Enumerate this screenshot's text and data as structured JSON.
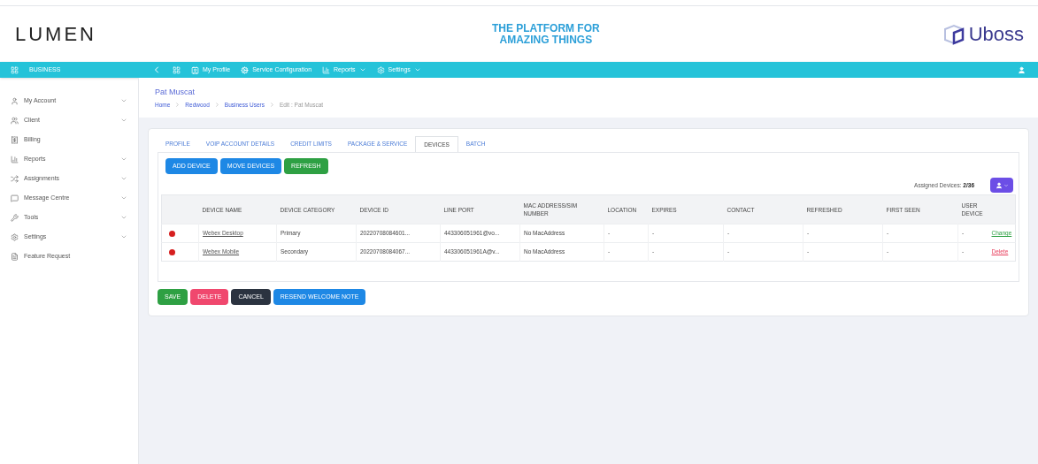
{
  "header": {
    "logo": "LUMEN",
    "tagline": [
      "THE PLATFORM FOR",
      "AMAZING THINGS"
    ],
    "brand": "Uboss"
  },
  "navbar": {
    "section": "BUSINESS",
    "items": [
      {
        "label": "My Profile",
        "kind": "profile",
        "dropdown": false
      },
      {
        "label": "Service Configuration",
        "kind": "config",
        "dropdown": false
      },
      {
        "label": "Reports",
        "kind": "reports",
        "dropdown": true
      },
      {
        "label": "Settings",
        "kind": "settings",
        "dropdown": true
      }
    ]
  },
  "sidebar": {
    "items": [
      {
        "label": "My Account",
        "kind": "user",
        "has_submenu": true
      },
      {
        "label": "Client",
        "kind": "users",
        "has_submenu": true
      },
      {
        "label": "Billing",
        "kind": "billing",
        "has_submenu": false
      },
      {
        "label": "Reports",
        "kind": "chart",
        "has_submenu": true
      },
      {
        "label": "Assignments",
        "kind": "assign",
        "has_submenu": true
      },
      {
        "label": "Message Centre",
        "kind": "message",
        "has_submenu": true
      },
      {
        "label": "Tools",
        "kind": "tools",
        "has_submenu": true
      },
      {
        "label": "Settings",
        "kind": "settings",
        "has_submenu": true
      },
      {
        "label": "Feature Request",
        "kind": "request",
        "has_submenu": false
      }
    ]
  },
  "page": {
    "title": "Pat Muscat",
    "breadcrumb": [
      {
        "label": "Home",
        "link": true
      },
      {
        "label": "Redwood",
        "link": true
      },
      {
        "label": "Business Users",
        "link": true
      },
      {
        "label": "Edit : Pat Muscat",
        "link": false
      }
    ]
  },
  "tabs": [
    {
      "label": "PROFILE",
      "selected": false
    },
    {
      "label": "VOIP ACCOUNT DETAILS",
      "selected": false
    },
    {
      "label": "CREDIT LIMITS",
      "selected": false
    },
    {
      "label": "PACKAGE & SERVICE",
      "selected": false
    },
    {
      "label": "DEVICES",
      "selected": true
    },
    {
      "label": "BATCH",
      "selected": false
    }
  ],
  "toolbar": {
    "buttons": [
      {
        "label": "ADD DEVICE",
        "kind": "primary"
      },
      {
        "label": "MOVE DEVICES",
        "kind": "primary"
      },
      {
        "label": "REFRESH",
        "kind": "success"
      }
    ],
    "assigned_label": "Assigned Devices:",
    "assigned_value": "2/36"
  },
  "table": {
    "columns": [
      "DEVICE NAME",
      "DEVICE CATEGORY",
      "DEVICE ID",
      "LINE PORT",
      "MAC ADDRESS/SIM NUMBER",
      "LOCATION",
      "EXPIRES",
      "CONTACT",
      "REFRESHED",
      "FIRST SEEN",
      "USER DEVICE"
    ],
    "rows": [
      {
        "color": "#d61f1f",
        "cells": [
          "Webex Desktop",
          "Primary",
          "20220708084601...",
          "443306051961@vo...",
          "No MacAddress",
          "-",
          "-",
          "-",
          "-",
          "-",
          "-"
        ],
        "action": {
          "label": "Change",
          "kind": "change"
        }
      },
      {
        "color": "#d61f1f",
        "cells": [
          "Webex Mobile",
          "Secondary",
          "20220708084067...",
          "443306051961A@v...",
          "No MacAddress",
          "-",
          "-",
          "-",
          "-",
          "-",
          "-"
        ],
        "action": {
          "label": "Delete",
          "kind": "delete"
        }
      }
    ]
  },
  "footer_buttons": [
    {
      "label": "SAVE",
      "kind": "success"
    },
    {
      "label": "DELETE",
      "kind": "danger"
    },
    {
      "label": "CANCEL",
      "kind": "dark"
    },
    {
      "label": "RESEND WELCOME NOTE",
      "kind": "primary"
    }
  ]
}
